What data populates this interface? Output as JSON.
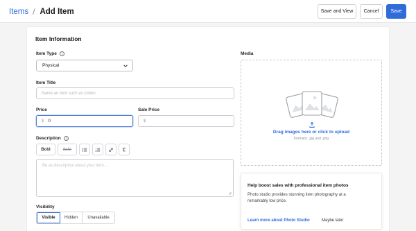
{
  "header": {
    "breadcrumb_parent": "Items",
    "breadcrumb_sep": "/",
    "title": "Add Item",
    "save_and_view": "Save and View",
    "cancel": "Cancel",
    "save": "Save"
  },
  "form": {
    "section_title": "Item Information",
    "item_type": {
      "label": "Item Type",
      "value": "Physical"
    },
    "item_title": {
      "label": "Item Title",
      "placeholder": "Name an item such as cotton"
    },
    "price": {
      "label": "Price",
      "prefix": "$",
      "value": "0"
    },
    "sale_price": {
      "label": "Sale Price",
      "prefix": "$"
    },
    "description": {
      "label": "Description",
      "toolbar": {
        "bold": "Bold",
        "italic": "Italic"
      },
      "placeholder": "Be as descriptive about your item..."
    },
    "visibility": {
      "label": "Visibility",
      "options": [
        "Visible",
        "Hidden",
        "Unavailable"
      ],
      "selected": "Visible"
    }
  },
  "media": {
    "label": "Media",
    "drop_text": "Drag images here or click to upload",
    "formats": "Formats: .jpg and .png"
  },
  "promo": {
    "title": "Help boost sales with professional item photos",
    "body": "Photo studio provides stunning item photography at a remarkably low price.",
    "link": "Learn more about Photo Studio",
    "dismiss": "Maybe later"
  },
  "colors": {
    "accent": "#2f6bd9",
    "page_bg": "#f4f4f5"
  }
}
